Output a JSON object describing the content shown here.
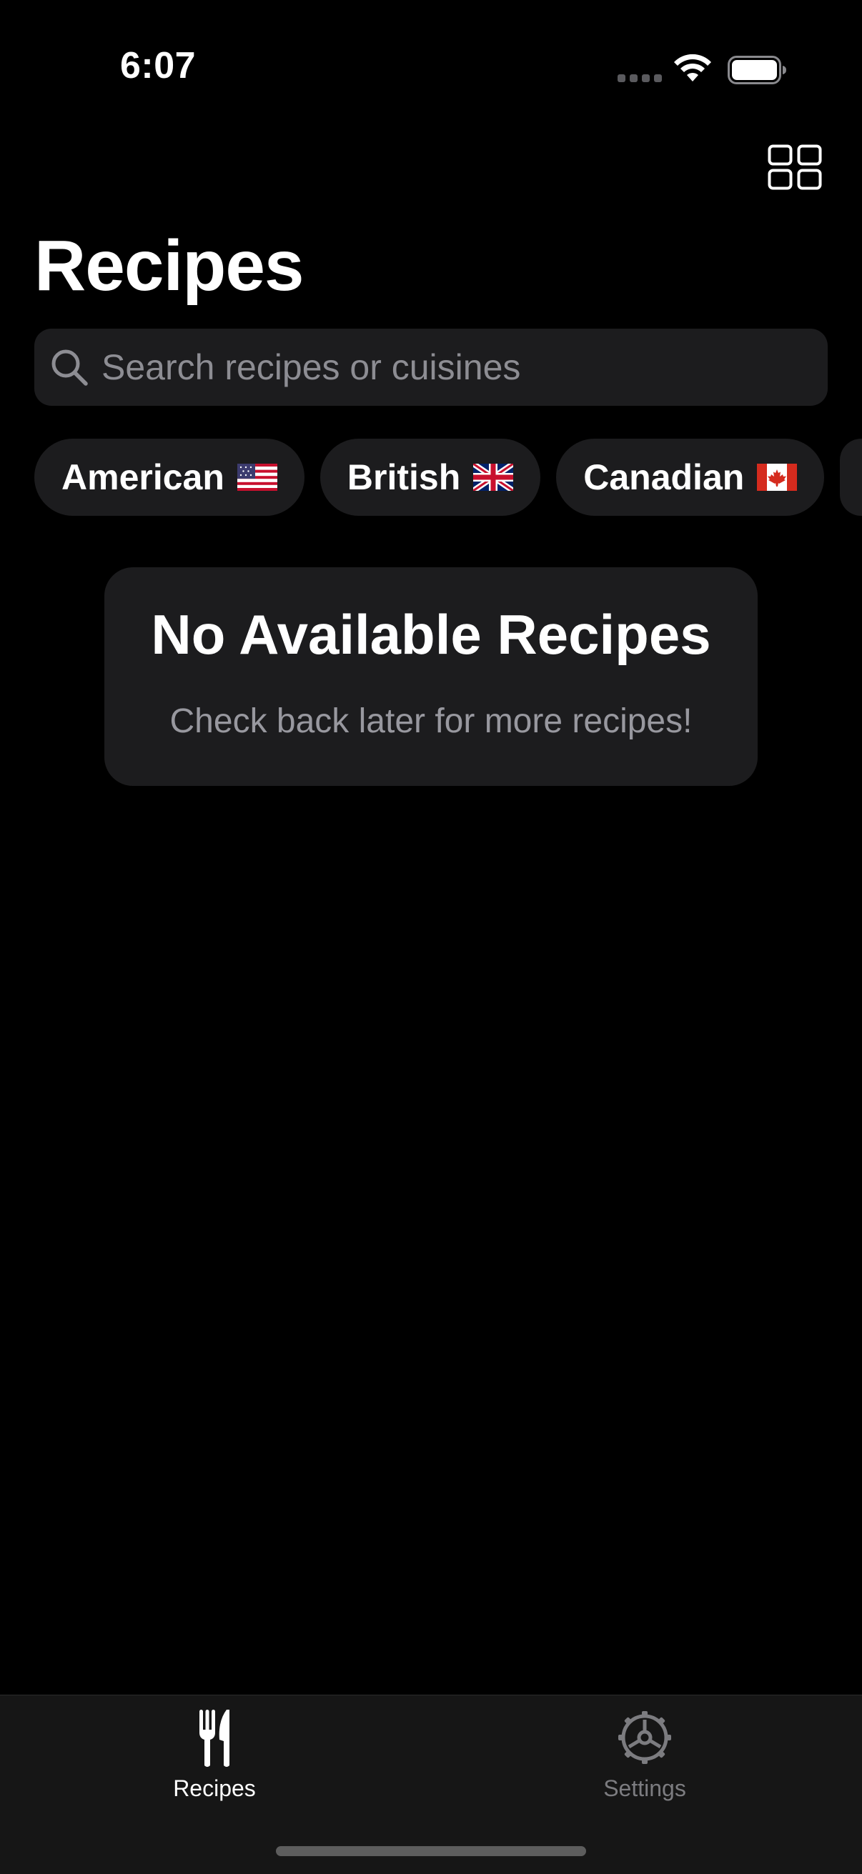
{
  "status_bar": {
    "time": "6:07"
  },
  "header": {
    "title": "Recipes",
    "layout_toggle_icon": "grid-icon"
  },
  "search": {
    "placeholder": "Search recipes or cuisines",
    "value": "",
    "icon": "search-icon"
  },
  "cuisines": [
    {
      "label": "American",
      "flag": "us-flag-icon"
    },
    {
      "label": "British",
      "flag": "uk-flag-icon"
    },
    {
      "label": "Canadian",
      "flag": "canada-flag-icon"
    }
  ],
  "empty_state": {
    "title": "No Available Recipes",
    "subtitle": "Check back later for more recipes!"
  },
  "tab_bar": {
    "tabs": [
      {
        "label": "Recipes",
        "icon": "fork-knife-icon",
        "selected": true
      },
      {
        "label": "Settings",
        "icon": "gear-icon",
        "selected": false
      }
    ]
  },
  "colors": {
    "background": "#000000",
    "surface": "#1c1c1e",
    "secondary_text": "#98989f",
    "tab_inactive": "#7c7c80"
  }
}
